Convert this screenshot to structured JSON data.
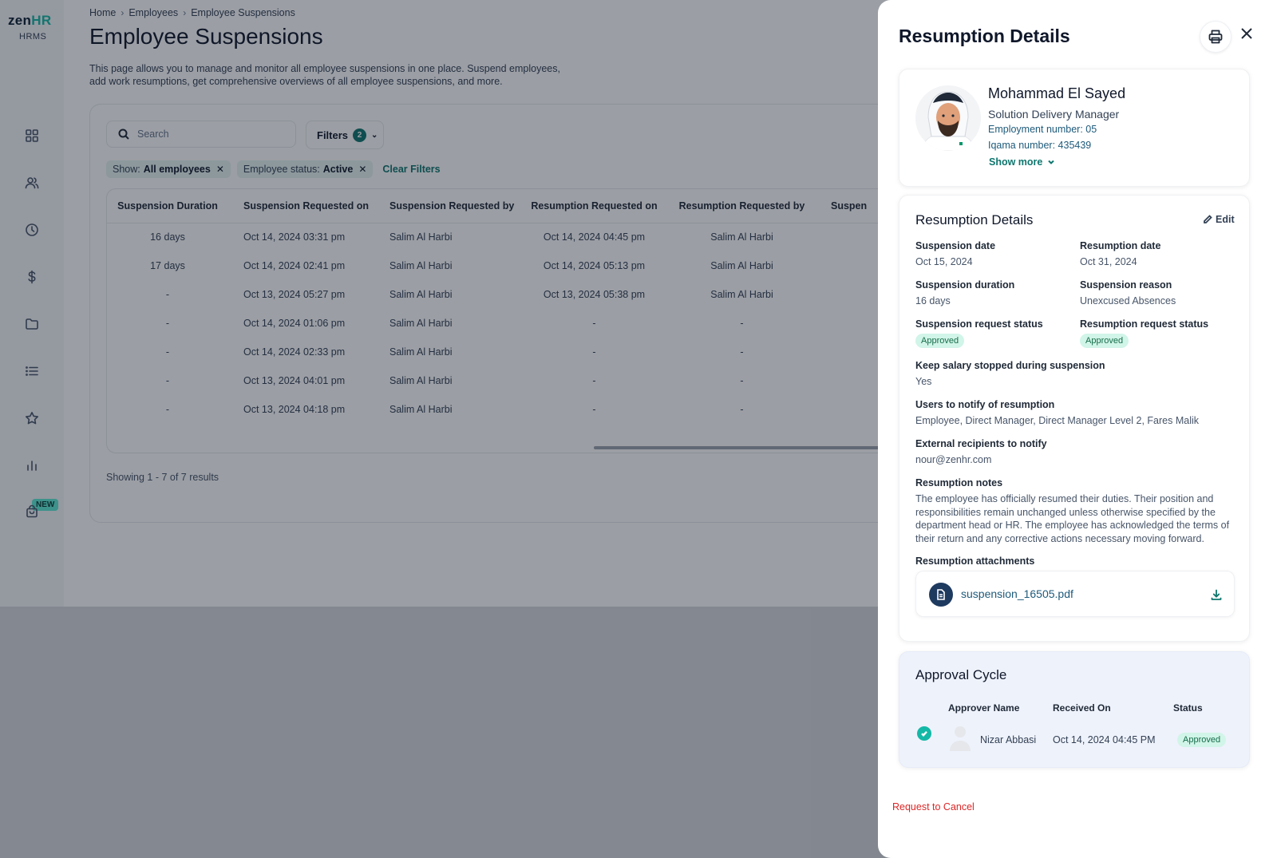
{
  "sidebar": {
    "logo_zen": "zen",
    "logo_hr": "HR",
    "logo_sub": "HRMS",
    "icons": [
      "dashboard-icon",
      "people-icon",
      "clock-icon",
      "dollar-icon",
      "folder-icon",
      "list-icon",
      "star-icon",
      "chart-icon",
      "bag-icon"
    ],
    "new_badge": "NEW"
  },
  "breadcrumb": {
    "home": "Home",
    "employees": "Employees",
    "current": "Employee Suspensions"
  },
  "page": {
    "title": "Employee Suspensions",
    "description": "This page allows you to manage and monitor all employee suspensions in one place. Suspend employees, add work resumptions, get comprehensive overviews of all employee suspensions, and more."
  },
  "toolbar": {
    "search_placeholder": "Search",
    "filters_label": "Filters",
    "filters_count": "2"
  },
  "chips": {
    "show_key": "Show:",
    "show_val": "All employees",
    "status_key": "Employee status:",
    "status_val": "Active",
    "clear": "Clear Filters"
  },
  "table": {
    "headers": [
      "Suspension Duration",
      "Suspension Requested on",
      "Suspension Requested by",
      "Resumption Requested on",
      "Resumption Requested by",
      "Suspen"
    ],
    "rows": [
      [
        "16 days",
        "Oct 14, 2024 03:31 pm",
        "Salim Al Harbi",
        "Oct 14, 2024 04:45 pm",
        "Salim Al Harbi"
      ],
      [
        "17 days",
        "Oct 14, 2024 02:41 pm",
        "Salim Al Harbi",
        "Oct 14, 2024 05:13 pm",
        "Salim Al Harbi"
      ],
      [
        "-",
        "Oct 13, 2024 05:27 pm",
        "Salim Al Harbi",
        "Oct 13, 2024 05:38 pm",
        "Salim Al Harbi"
      ],
      [
        "-",
        "Oct 14, 2024 01:06 pm",
        "Salim Al Harbi",
        "-",
        "-"
      ],
      [
        "-",
        "Oct 14, 2024 02:33 pm",
        "Salim Al Harbi",
        "-",
        "-"
      ],
      [
        "-",
        "Oct 13, 2024 04:01 pm",
        "Salim Al Harbi",
        "-",
        "-"
      ],
      [
        "-",
        "Oct 13, 2024 04:18 pm",
        "Salim Al Harbi",
        "-",
        "-"
      ]
    ],
    "results": "Showing 1 - 7 of 7 results"
  },
  "drawer": {
    "title": "Resumption Details",
    "employee": {
      "name": "Mohammad El Sayed",
      "role": "Solution Delivery Manager",
      "employment_number": "Employment number: 05",
      "iqama_number": "Iqama number: 435439",
      "show_more": "Show more"
    },
    "details": {
      "title": "Resumption Details",
      "edit": "Edit",
      "suspension_date_label": "Suspension date",
      "suspension_date": "Oct 15, 2024",
      "resumption_date_label": "Resumption date",
      "resumption_date": "Oct 31, 2024",
      "suspension_duration_label": "Suspension duration",
      "suspension_duration": "16 days",
      "suspension_reason_label": "Suspension reason",
      "suspension_reason": "Unexcused Absences",
      "suspension_status_label": "Suspension request status",
      "suspension_status": "Approved",
      "resumption_status_label": "Resumption request status",
      "resumption_status": "Approved",
      "keep_salary_label": "Keep salary stopped during suspension",
      "keep_salary": "Yes",
      "users_notify_label": "Users to notify of resumption",
      "users_notify": "Employee, Direct Manager, Direct Manager Level 2, Fares Malik",
      "external_label": "External recipients to notify",
      "external": "nour@zenhr.com",
      "notes_label": "Resumption notes",
      "notes": "The employee has officially resumed their duties. Their position and responsibilities remain unchanged unless otherwise specified by the department head or HR. The employee has acknowledged the terms of their return and any corrective actions necessary moving forward.",
      "attachments_label": "Resumption attachments",
      "attachment_name": "suspension_16505.pdf"
    },
    "approval": {
      "title": "Approval Cycle",
      "col_name": "Approver Name",
      "col_received": "Received On",
      "col_status": "Status",
      "approver": "Nizar Abbasi",
      "received": "Oct 14, 2024 04:45 PM",
      "status": "Approved"
    },
    "cancel": "Request to Cancel"
  },
  "colors": {
    "brand_teal": "#14b8a6",
    "link_teal": "#0f766e",
    "approved_bg": "#d1f5e8",
    "approved_text": "#166c4b",
    "danger": "#dc2626"
  }
}
